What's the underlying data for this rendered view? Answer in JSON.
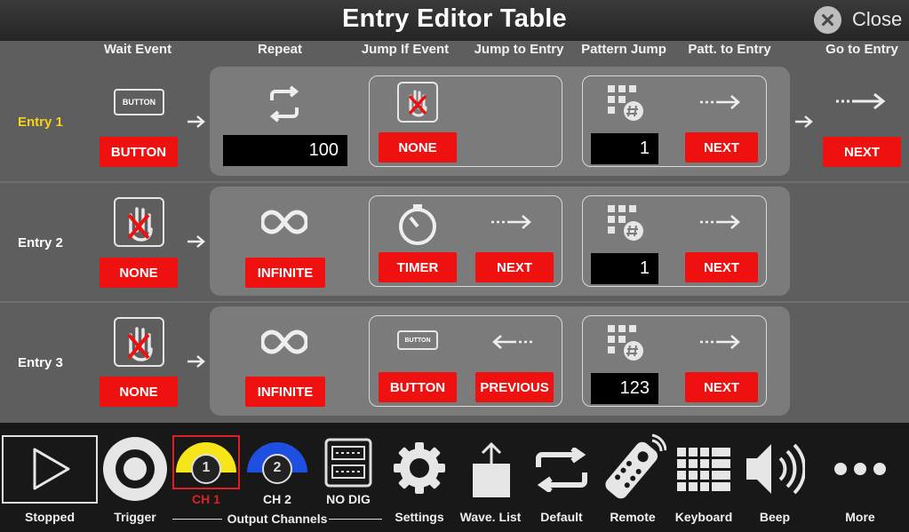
{
  "title": "Entry Editor Table",
  "close_label": "Close",
  "columns": {
    "wait_event": "Wait Event",
    "repeat": "Repeat",
    "jump_if_event": "Jump If Event",
    "jump_to_entry": "Jump to Entry",
    "pattern_jump": "Pattern Jump",
    "patt_to_entry": "Patt. to Entry",
    "go_to_entry": "Go to Entry"
  },
  "entries": [
    {
      "label": "Entry  1",
      "wait": "BUTTON",
      "repeat_value": "100",
      "jump_event": "NONE",
      "pattern_value": "1",
      "patt_to": "NEXT",
      "go_to": "NEXT"
    },
    {
      "label": "Entry  2",
      "wait": "NONE",
      "repeat": "INFINITE",
      "jump_event": "TIMER",
      "jump_to": "NEXT",
      "pattern_value": "1",
      "patt_to": "NEXT"
    },
    {
      "label": "Entry  3",
      "wait": "NONE",
      "repeat": "INFINITE",
      "jump_event": "BUTTON",
      "jump_to": "PREVIOUS",
      "pattern_value": "123",
      "patt_to": "NEXT"
    }
  ],
  "button_icon_text": "BUTTON",
  "bottom": {
    "stopped": "Stopped",
    "trigger": "Trigger",
    "ch1": "CH 1",
    "ch1_num": "1",
    "ch2": "CH 2",
    "ch2_num": "2",
    "no_dig": "NO DIG",
    "output_channels": "Output Channels",
    "settings": "Settings",
    "wave_list": "Wave. List",
    "default": "Default",
    "remote": "Remote",
    "keyboard": "Keyboard",
    "beep": "Beep",
    "more": "More"
  },
  "colors": {
    "accent_red": "#ef1010",
    "active_entry": "#f7d21c",
    "ch1": "#f5e51a",
    "ch2": "#1f4fe0"
  }
}
